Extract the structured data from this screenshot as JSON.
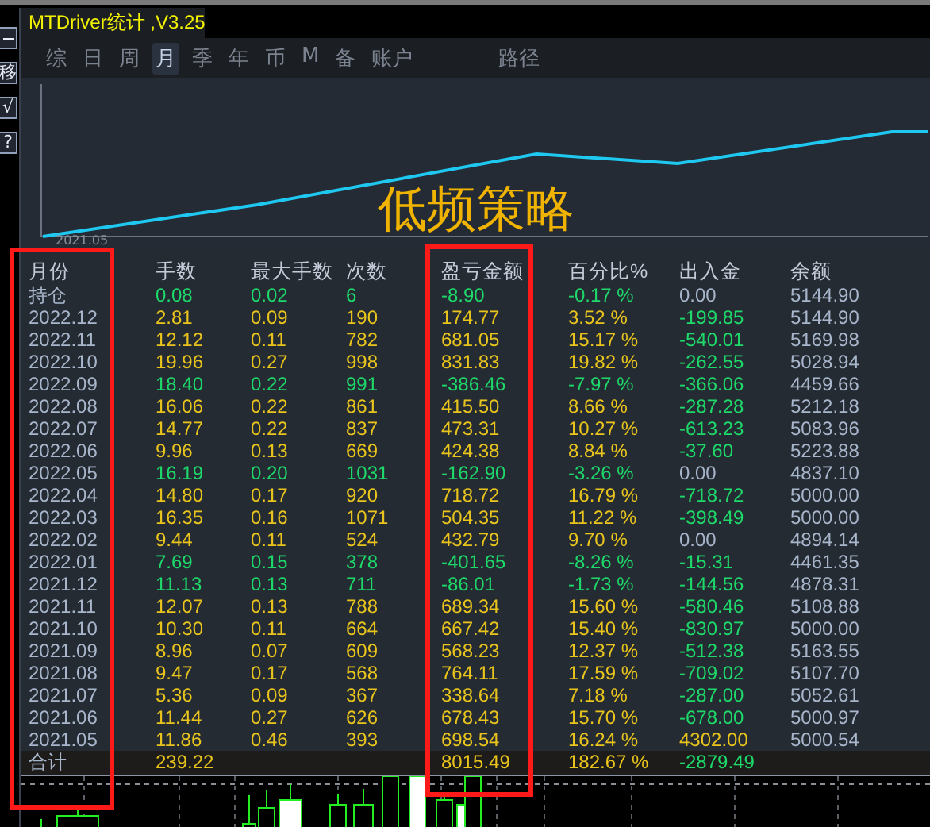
{
  "left_toolbar": [
    "移",
    "√",
    "?"
  ],
  "window": {
    "title": "MTDriver统计 ,V3.25"
  },
  "tabs": [
    {
      "label": "综",
      "selected": false
    },
    {
      "label": "日",
      "selected": false
    },
    {
      "label": "周",
      "selected": false
    },
    {
      "label": "月",
      "selected": true
    },
    {
      "label": "季",
      "selected": false
    },
    {
      "label": "年",
      "selected": false
    },
    {
      "label": "币",
      "selected": false
    },
    {
      "label": "M",
      "selected": false
    },
    {
      "label": "备",
      "selected": false
    },
    {
      "label": "账户",
      "selected": false
    }
  ],
  "path_tab": {
    "label": "路径",
    "selected": false
  },
  "chart": {
    "overlay_title": "低频策略",
    "x_label": "2021.05"
  },
  "table": {
    "columns": [
      "月份",
      "手数",
      "最大手数",
      "次数",
      "盈亏金额",
      "百分比%",
      "出入金",
      "余额"
    ],
    "rows": [
      {
        "month": "持仓",
        "lots": "0.08",
        "max_lots": "0.02",
        "trades": "6",
        "profit": "-8.90",
        "percent": "-0.17 %",
        "flow": {
          "text": "0.00",
          "color": "#a8b6cc"
        },
        "balance": "5144.90",
        "color": "#1ed86a"
      },
      {
        "month": "2022.12",
        "lots": "2.81",
        "max_lots": "0.09",
        "trades": "190",
        "profit": "174.77",
        "percent": "3.52 %",
        "flow": {
          "text": "-199.85",
          "color": "#1ed86a"
        },
        "balance": "5144.90",
        "color": "#e8c41c"
      },
      {
        "month": "2022.11",
        "lots": "12.12",
        "max_lots": "0.11",
        "trades": "782",
        "profit": "681.05",
        "percent": "15.17 %",
        "flow": {
          "text": "-540.01",
          "color": "#1ed86a"
        },
        "balance": "5169.98",
        "color": "#e8c41c"
      },
      {
        "month": "2022.10",
        "lots": "19.96",
        "max_lots": "0.27",
        "trades": "998",
        "profit": "831.83",
        "percent": "19.82 %",
        "flow": {
          "text": "-262.55",
          "color": "#1ed86a"
        },
        "balance": "5028.94",
        "color": "#e8c41c"
      },
      {
        "month": "2022.09",
        "lots": "18.40",
        "max_lots": "0.22",
        "trades": "991",
        "profit": "-386.46",
        "percent": "-7.97 %",
        "flow": {
          "text": "-366.06",
          "color": "#1ed86a"
        },
        "balance": "4459.66",
        "color": "#1ed86a"
      },
      {
        "month": "2022.08",
        "lots": "16.06",
        "max_lots": "0.22",
        "trades": "861",
        "profit": "415.50",
        "percent": "8.66 %",
        "flow": {
          "text": "-287.28",
          "color": "#1ed86a"
        },
        "balance": "5212.18",
        "color": "#e8c41c"
      },
      {
        "month": "2022.07",
        "lots": "14.77",
        "max_lots": "0.22",
        "trades": "837",
        "profit": "473.31",
        "percent": "10.27 %",
        "flow": {
          "text": "-613.23",
          "color": "#1ed86a"
        },
        "balance": "5083.96",
        "color": "#e8c41c"
      },
      {
        "month": "2022.06",
        "lots": "9.96",
        "max_lots": "0.13",
        "trades": "669",
        "profit": "424.38",
        "percent": "8.84 %",
        "flow": {
          "text": "-37.60",
          "color": "#1ed86a"
        },
        "balance": "5223.88",
        "color": "#e8c41c"
      },
      {
        "month": "2022.05",
        "lots": "16.19",
        "max_lots": "0.20",
        "trades": "1031",
        "profit": "-162.90",
        "percent": "-3.26 %",
        "flow": {
          "text": "0.00",
          "color": "#a8b6cc"
        },
        "balance": "4837.10",
        "color": "#1ed86a"
      },
      {
        "month": "2022.04",
        "lots": "14.80",
        "max_lots": "0.17",
        "trades": "920",
        "profit": "718.72",
        "percent": "16.79 %",
        "flow": {
          "text": "-718.72",
          "color": "#1ed86a"
        },
        "balance": "5000.00",
        "color": "#e8c41c"
      },
      {
        "month": "2022.03",
        "lots": "16.35",
        "max_lots": "0.16",
        "trades": "1071",
        "profit": "504.35",
        "percent": "11.22 %",
        "flow": {
          "text": "-398.49",
          "color": "#1ed86a"
        },
        "balance": "5000.00",
        "color": "#e8c41c"
      },
      {
        "month": "2022.02",
        "lots": "9.44",
        "max_lots": "0.11",
        "trades": "524",
        "profit": "432.79",
        "percent": "9.70 %",
        "flow": {
          "text": "0.00",
          "color": "#a8b6cc"
        },
        "balance": "4894.14",
        "color": "#e8c41c"
      },
      {
        "month": "2022.01",
        "lots": "7.69",
        "max_lots": "0.15",
        "trades": "378",
        "profit": "-401.65",
        "percent": "-8.26 %",
        "flow": {
          "text": "-15.31",
          "color": "#1ed86a"
        },
        "balance": "4461.35",
        "color": "#1ed86a"
      },
      {
        "month": "2021.12",
        "lots": "11.13",
        "max_lots": "0.13",
        "trades": "711",
        "profit": "-86.01",
        "percent": "-1.73 %",
        "flow": {
          "text": "-144.56",
          "color": "#1ed86a"
        },
        "balance": "4878.31",
        "color": "#1ed86a"
      },
      {
        "month": "2021.11",
        "lots": "12.07",
        "max_lots": "0.13",
        "trades": "788",
        "profit": "689.34",
        "percent": "15.60 %",
        "flow": {
          "text": "-580.46",
          "color": "#1ed86a"
        },
        "balance": "5108.88",
        "color": "#e8c41c"
      },
      {
        "month": "2021.10",
        "lots": "10.30",
        "max_lots": "0.11",
        "trades": "664",
        "profit": "667.42",
        "percent": "15.40 %",
        "flow": {
          "text": "-830.97",
          "color": "#1ed86a"
        },
        "balance": "5000.00",
        "color": "#e8c41c"
      },
      {
        "month": "2021.09",
        "lots": "8.96",
        "max_lots": "0.07",
        "trades": "609",
        "profit": "568.23",
        "percent": "12.37 %",
        "flow": {
          "text": "-512.38",
          "color": "#1ed86a"
        },
        "balance": "5163.55",
        "color": "#e8c41c"
      },
      {
        "month": "2021.08",
        "lots": "9.47",
        "max_lots": "0.17",
        "trades": "568",
        "profit": "764.11",
        "percent": "17.59 %",
        "flow": {
          "text": "-709.02",
          "color": "#1ed86a"
        },
        "balance": "5107.70",
        "color": "#e8c41c"
      },
      {
        "month": "2021.07",
        "lots": "5.36",
        "max_lots": "0.09",
        "trades": "367",
        "profit": "338.64",
        "percent": "7.18 %",
        "flow": {
          "text": "-287.00",
          "color": "#1ed86a"
        },
        "balance": "5052.61",
        "color": "#e8c41c"
      },
      {
        "month": "2021.06",
        "lots": "11.44",
        "max_lots": "0.27",
        "trades": "626",
        "profit": "678.43",
        "percent": "15.70 %",
        "flow": {
          "text": "-678.00",
          "color": "#1ed86a"
        },
        "balance": "5000.97",
        "color": "#e8c41c"
      },
      {
        "month": "2021.05",
        "lots": "11.86",
        "max_lots": "0.46",
        "trades": "393",
        "profit": "698.54",
        "percent": "16.24 %",
        "flow": {
          "text": "4302.00",
          "color": "#e8c41c"
        },
        "balance": "5000.54",
        "color": "#e8c41c"
      }
    ],
    "total": {
      "label": "合计",
      "lots": "239.22",
      "profit": "8015.49",
      "percent": "182.67 %",
      "flow": {
        "text": "-2879.49",
        "color": "#1ed86a"
      }
    }
  }
}
